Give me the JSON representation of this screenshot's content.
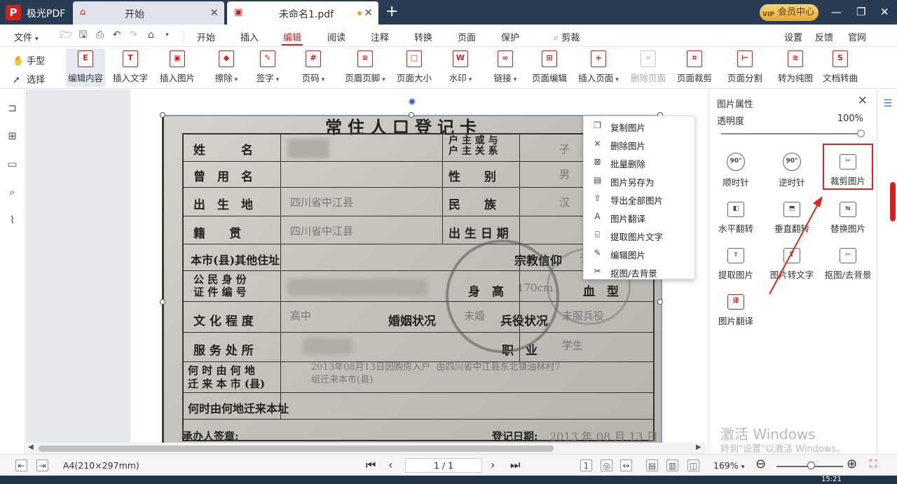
{
  "app": {
    "name": "极光PDF",
    "logo": "P"
  },
  "tabs": [
    {
      "label": "开始",
      "icon": "home-icon"
    },
    {
      "label": "未命名1.pdf",
      "icon": "pdf-icon",
      "modified": true
    }
  ],
  "vip": {
    "label": "会员中心",
    "badge": "VIP"
  },
  "menu": {
    "file": "文件",
    "items": [
      "开始",
      "插入",
      "编辑",
      "阅读",
      "注释",
      "转换",
      "页面",
      "保护"
    ],
    "active": "编辑",
    "search_label": "剪裁",
    "right": [
      "设置",
      "反馈",
      "官网"
    ]
  },
  "toolbar": {
    "modes": [
      "手型",
      "选择"
    ],
    "tools": [
      {
        "label": "编辑内容",
        "glyph": "E"
      },
      {
        "label": "插入文字",
        "glyph": "T"
      },
      {
        "label": "插入图片",
        "glyph": "▣"
      },
      {
        "label": "擦除",
        "glyph": "◆",
        "caret": true
      },
      {
        "label": "签字",
        "glyph": "✎",
        "caret": true
      },
      {
        "label": "页码",
        "glyph": "#",
        "caret": true
      },
      {
        "label": "页眉页脚",
        "glyph": "≡",
        "caret": true
      },
      {
        "label": "页面大小",
        "glyph": "□"
      },
      {
        "label": "水印",
        "glyph": "W",
        "caret": true
      },
      {
        "label": "链接",
        "glyph": "∞",
        "caret": true
      },
      {
        "label": "页面编辑",
        "glyph": "⊞"
      },
      {
        "label": "插入页面",
        "glyph": "+",
        "caret": true
      },
      {
        "label": "删除页面",
        "glyph": "×",
        "disabled": true
      },
      {
        "label": "页面裁剪",
        "glyph": "⌗"
      },
      {
        "label": "页面分割",
        "glyph": "⊢"
      },
      {
        "label": "转为纯图",
        "glyph": "≋"
      },
      {
        "label": "文档转曲",
        "glyph": "S"
      }
    ]
  },
  "document": {
    "card_title": "常住人口登记卡",
    "labels": {
      "name": "姓　　　名",
      "relation": "户 主 或 与\n户 主 关 系",
      "former_name": "曾　用　名",
      "gender": "性　　别",
      "birthplace": "出　生　地",
      "ethnicity": "民　　族",
      "native": "籍　　贯",
      "birthdate": "出 生 日 期",
      "other_address": "本市(县)其他住址",
      "religion": "宗教信仰",
      "id_number": "公 民 身 份\n证 件 编 号",
      "height": "身　高",
      "blood": "血　型",
      "education": "文 化 程 度",
      "marital": "婚姻状况",
      "military": "兵役状况",
      "workplace": "服 务 处 所",
      "occupation": "职　业",
      "when_from": "何 时 由 何 地\n迁 来 本 市 (县)",
      "when_from_address": "何时由何地迁来本址",
      "officer": "承办人签章:",
      "reg_date": "登记日期:"
    },
    "values": {
      "relation": "子",
      "gender": "男",
      "birthplace": "四川省中江县",
      "ethnicity": "汉",
      "native": "四川省中江县",
      "religion": "无宗",
      "height": "170cm",
      "education": "高中",
      "marital": "未婚",
      "military": "未服兵役",
      "occupation": "学生",
      "move_note": "2013年08月13日因购房入户  由四川省中江县东北镇油林村7\n组迁来本市(县)",
      "reg_date": "2013 年 08 月 13 日"
    }
  },
  "context_menu": [
    {
      "label": "复制图片",
      "icon": "copy-icon",
      "glyph": "❐"
    },
    {
      "label": "删除图片",
      "icon": "delete-icon",
      "glyph": "✕"
    },
    {
      "label": "批量删除",
      "icon": "batch-delete-icon",
      "glyph": "⊠"
    },
    {
      "label": "图片另存为",
      "icon": "save-as-icon",
      "glyph": "▤"
    },
    {
      "label": "导出全部图片",
      "icon": "export-icon",
      "glyph": "⇧"
    },
    {
      "label": "图片翻译",
      "icon": "translate-icon",
      "glyph": "A"
    },
    {
      "label": "提取图片文字",
      "icon": "ocr-icon",
      "glyph": "⌸"
    },
    {
      "label": "编辑图片",
      "icon": "edit-image-icon",
      "glyph": "✎"
    },
    {
      "label": "抠图/去背景",
      "icon": "cutout-icon",
      "glyph": "✂"
    }
  ],
  "panel": {
    "title": "图片属性",
    "opacity_label": "透明度",
    "opacity_value": "100%",
    "opacity_fraction": 1.0,
    "tools": [
      {
        "label": "顺时针",
        "glyph": "90°"
      },
      {
        "label": "逆时针",
        "glyph": "90°"
      },
      {
        "label": "裁剪图片",
        "glyph": "✂"
      },
      {
        "label": "水平翻转",
        "glyph": "◧"
      },
      {
        "label": "垂直翻转",
        "glyph": "⬒"
      },
      {
        "label": "替换图片",
        "glyph": "⇆"
      },
      {
        "label": "提取图片",
        "glyph": "⇧"
      },
      {
        "label": "图片转文字",
        "glyph": "T"
      },
      {
        "label": "抠图/去背景",
        "glyph": "✂"
      },
      {
        "label": "图片翻译",
        "glyph": "译"
      }
    ]
  },
  "watermark": {
    "title": "激活 Windows",
    "subtitle": "转到\"设置\"以激活 Windows。"
  },
  "status": {
    "page_size": "A4(210×297mm)",
    "page_indicator": "1 / 1",
    "zoom": "169%",
    "zoom_fraction": 0.5,
    "time": "15:21"
  }
}
